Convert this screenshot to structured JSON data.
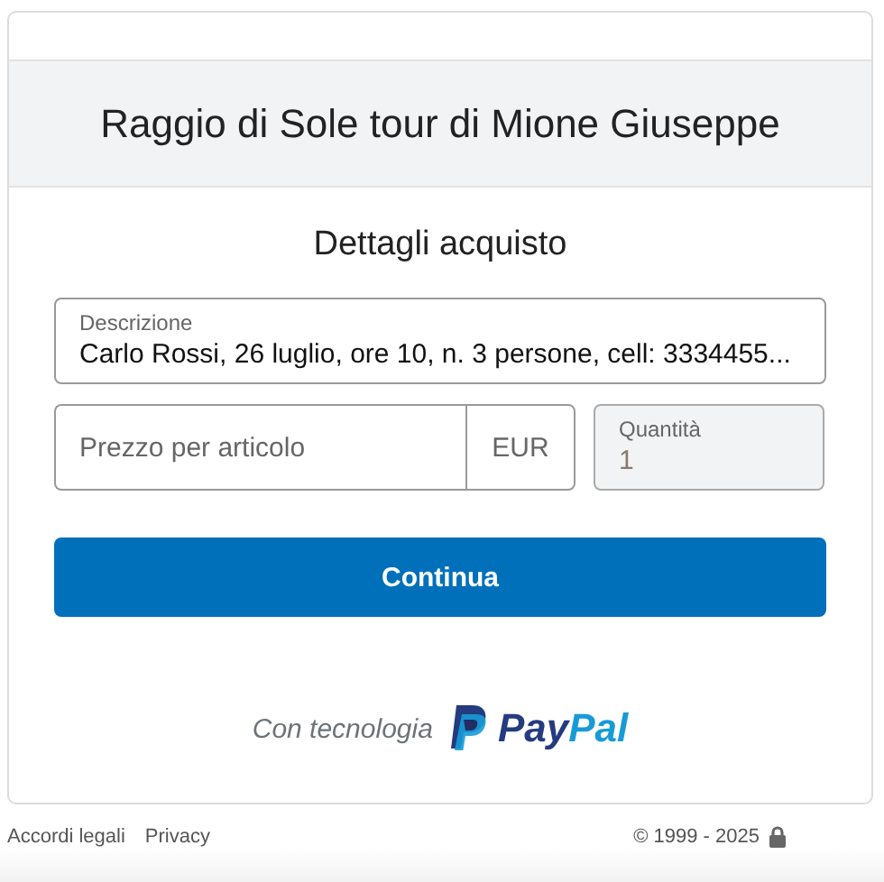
{
  "header": {
    "title": "Raggio di Sole tour di Mione Giuseppe"
  },
  "form": {
    "heading": "Dettagli acquisto",
    "description": {
      "label": "Descrizione",
      "value": "Carlo Rossi, 26 luglio, ore 10, n. 3 persone, cell: 3334455..."
    },
    "price": {
      "placeholder": "Prezzo per articolo",
      "currency": "EUR"
    },
    "quantity": {
      "label": "Quantità",
      "value": "1",
      "disabled": true
    },
    "submit": "Continua"
  },
  "powered_by": {
    "text": "Con tecnologia",
    "logo_parts": [
      "Pay",
      "Pal"
    ]
  },
  "footer": {
    "links": [
      "Accordi legali",
      "Privacy"
    ],
    "copyright": "© 1999 - 2025"
  }
}
